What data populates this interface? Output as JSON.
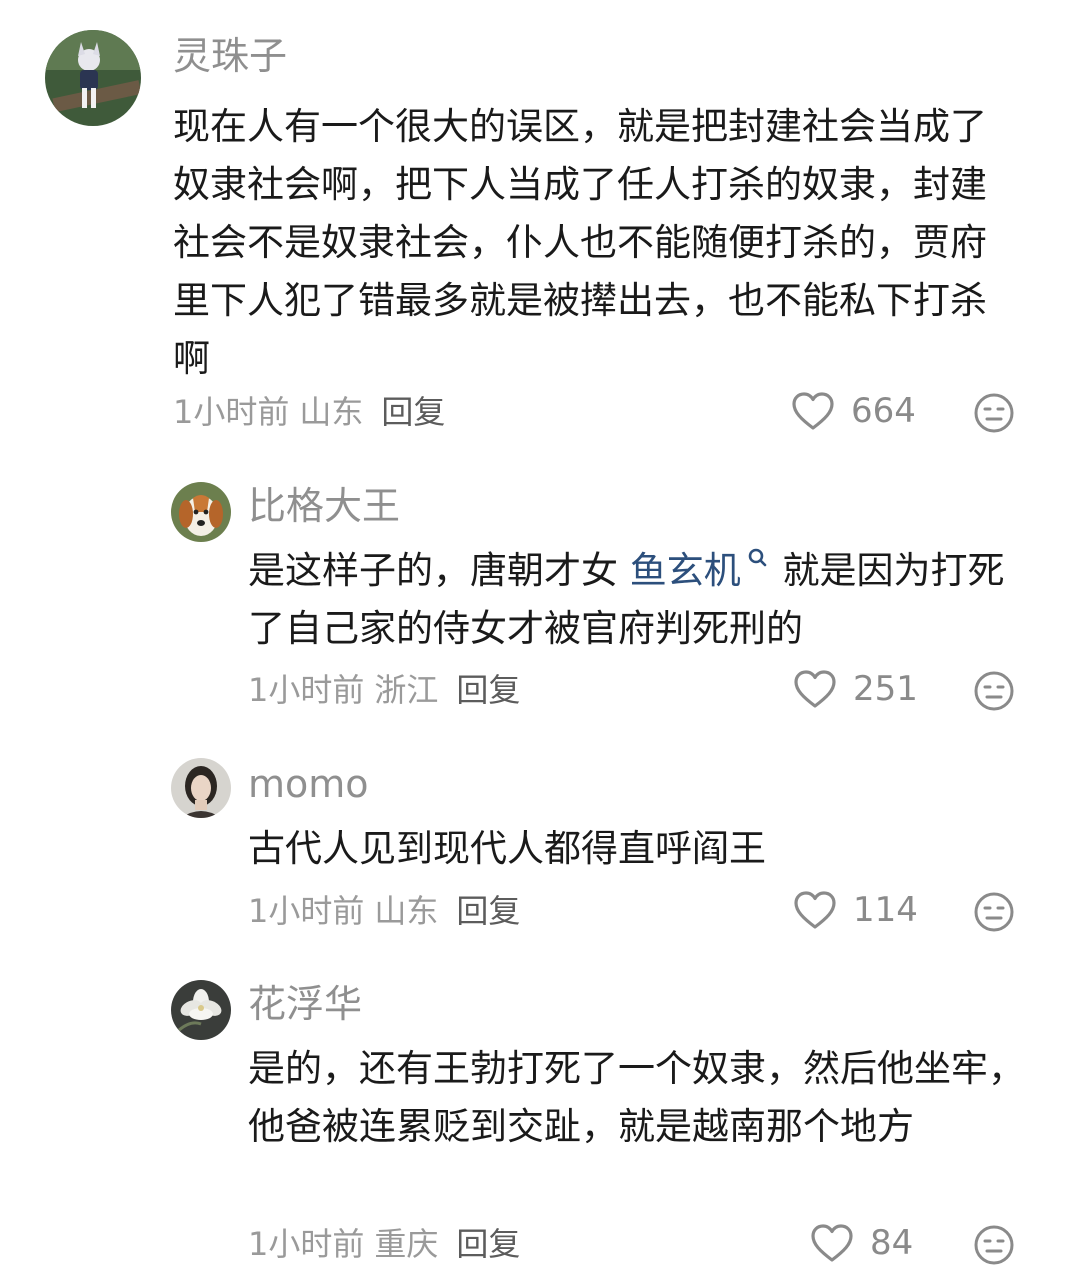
{
  "comments": [
    {
      "username": "灵珠子",
      "text": "现在人有一个很大的误区，就是把封建社会当成了奴隶社会啊，把下人当成了任人打杀的奴隶，封建社会不是奴隶社会，仆人也不能随便打杀的，贾府里下人犯了错最多就是被撵出去，也不能私下打杀啊",
      "time": "1小时前",
      "location": "山东",
      "reply_label": "回复",
      "likes": "664",
      "avatar": "doll-figure-avatar"
    },
    {
      "username": "比格大王",
      "text_before": "是这样子的，唐朝才女 ",
      "link_text": "鱼玄机",
      "text_after": " 就是因为打死了自己家的侍女才被官府判死刑的",
      "time": "1小时前",
      "location": "浙江",
      "reply_label": "回复",
      "likes": "251",
      "avatar": "beagle-dog-avatar"
    },
    {
      "username": "momo",
      "text": "古代人见到现代人都得直呼阎王",
      "time": "1小时前",
      "location": "山东",
      "reply_label": "回复",
      "likes": "114",
      "avatar": "woman-portrait-avatar"
    },
    {
      "username": "花浮华",
      "text": "是的，还有王勃打死了一个奴隶，然后他坐牢，他爸被连累贬到交趾，就是越南那个地方",
      "time": "1小时前",
      "location": "重庆",
      "reply_label": "回复",
      "likes": "84",
      "avatar": "white-flower-avatar"
    }
  ],
  "colors": {
    "link": "#2c4f7c",
    "username": "#8f8f8f",
    "meta": "#9a9a9a",
    "body": "#1a1a1a"
  }
}
